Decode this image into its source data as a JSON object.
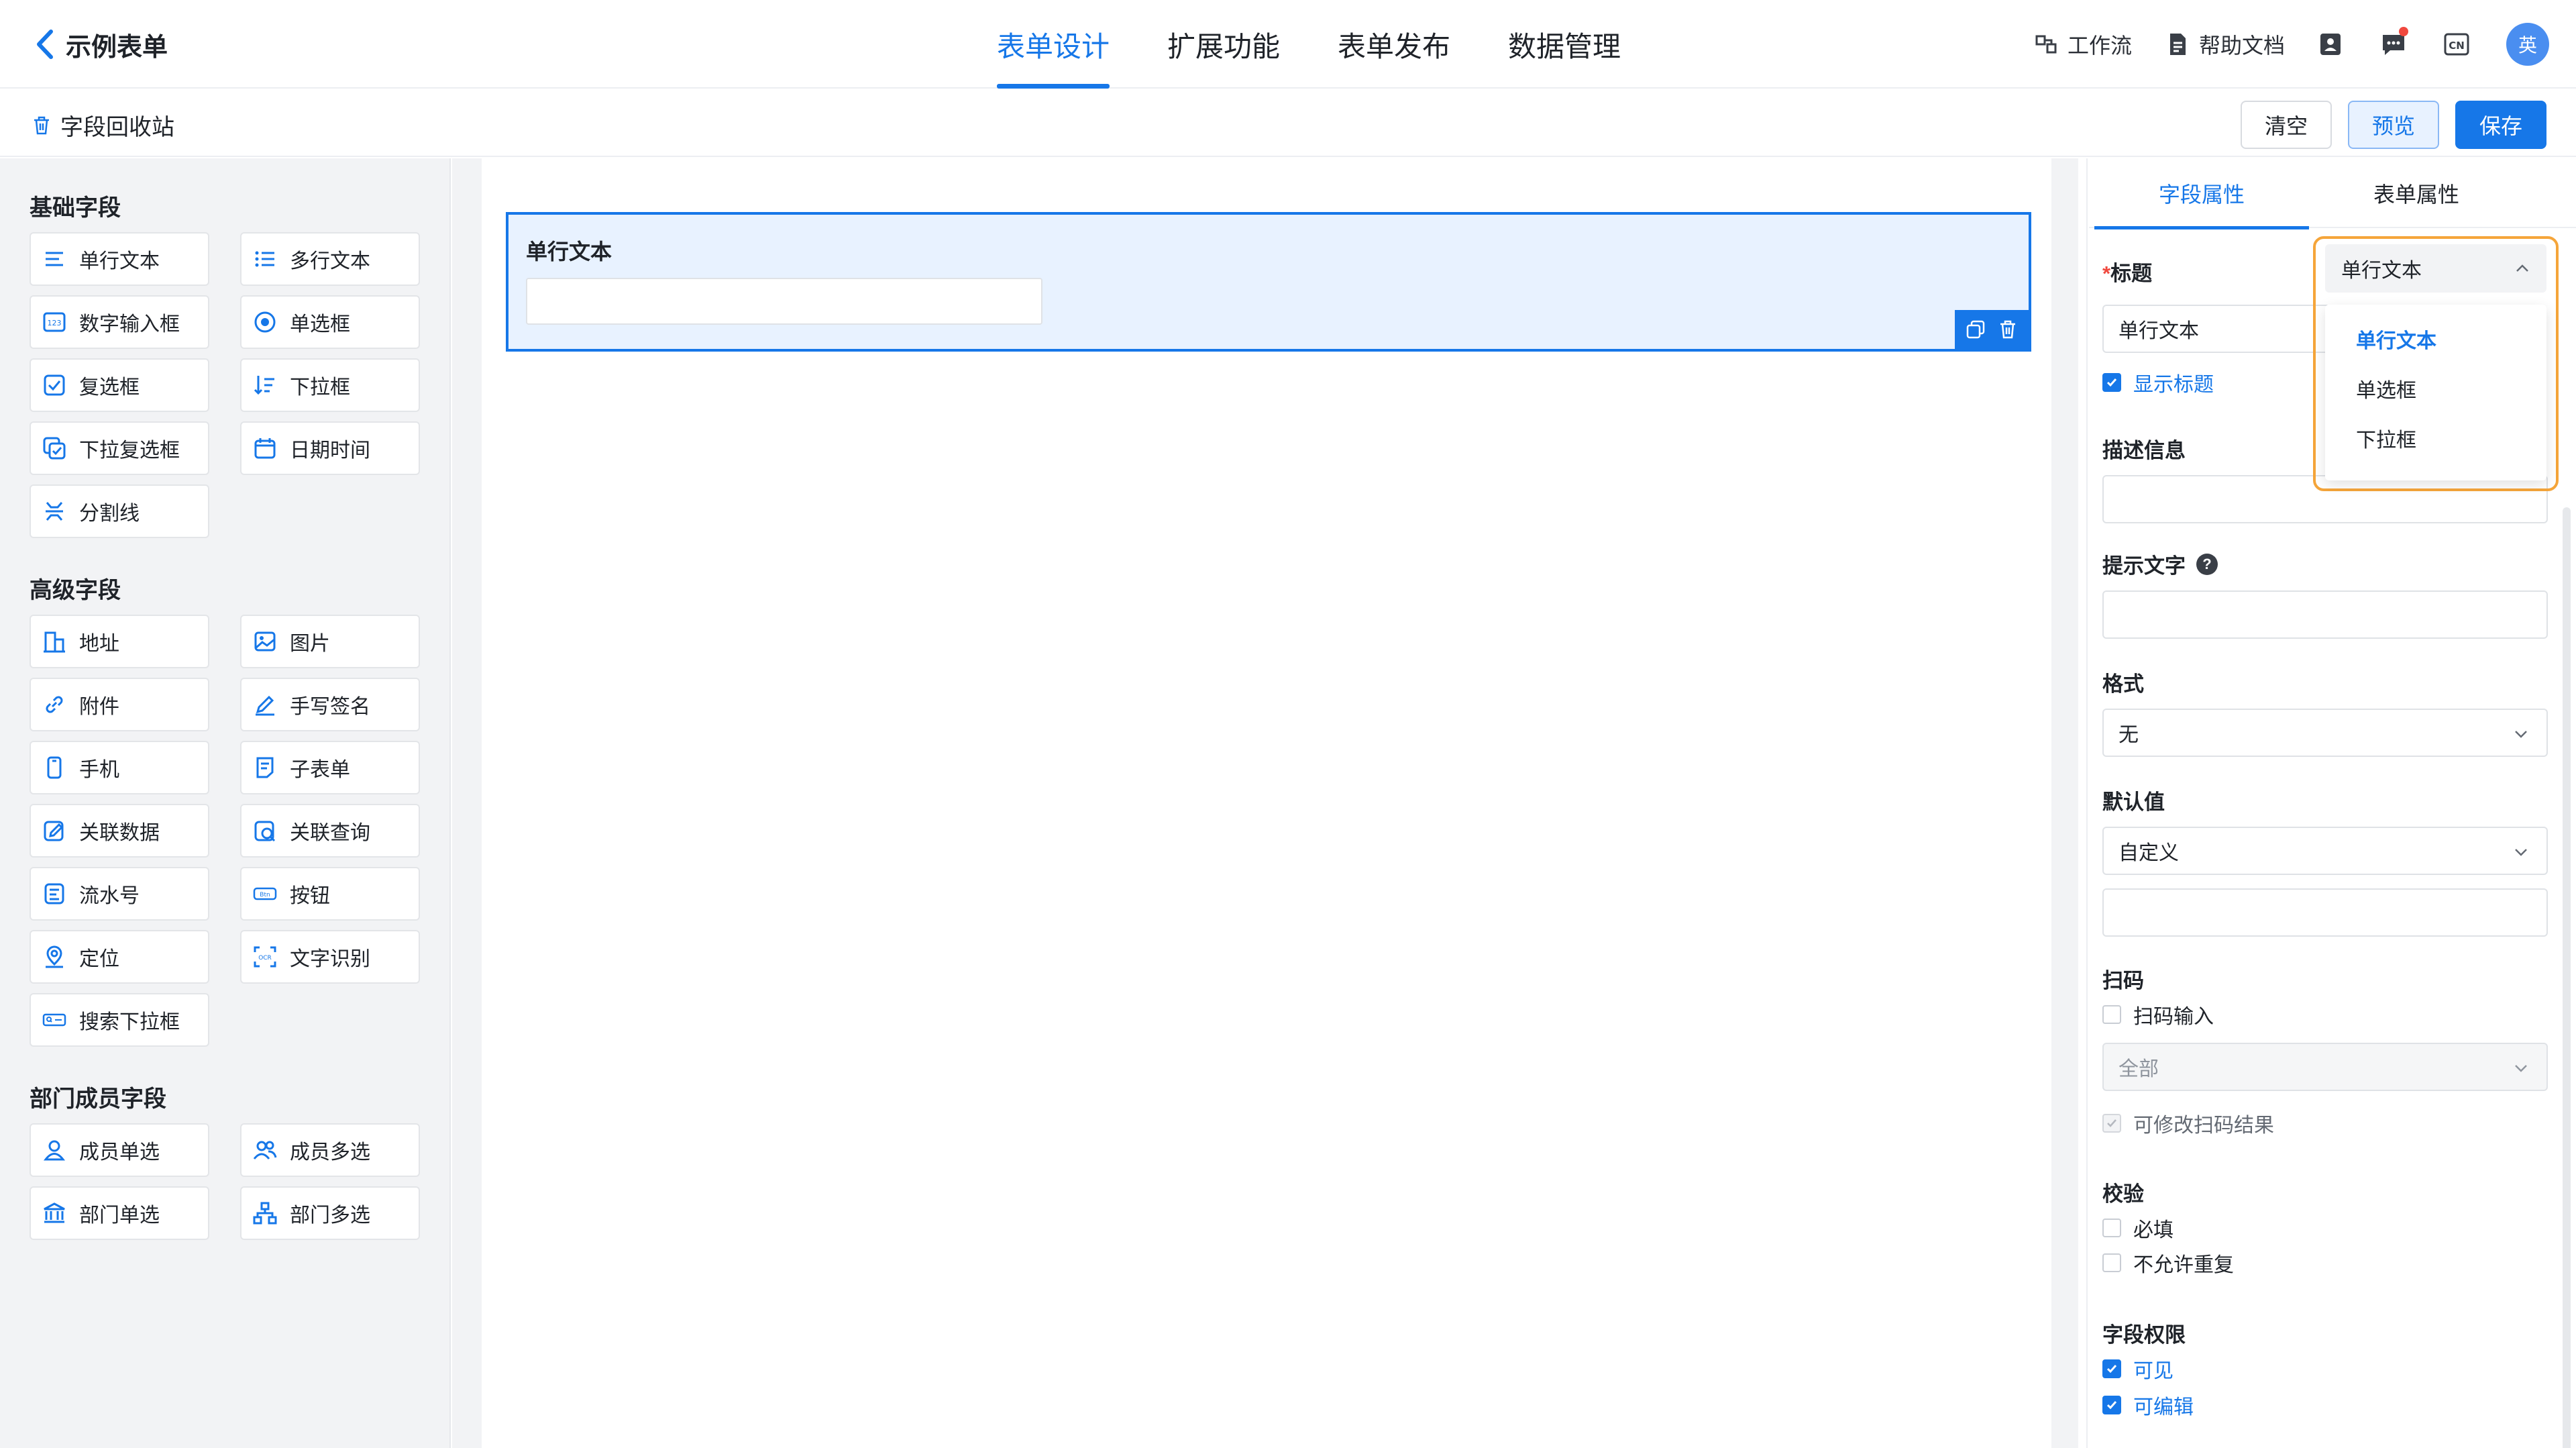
{
  "header": {
    "title": "示例表单",
    "tabs": [
      "表单设计",
      "扩展功能",
      "表单发布",
      "数据管理"
    ],
    "workflow": "工作流",
    "help_docs": "帮助文档",
    "lang_icon_text": "CN",
    "avatar_text": "英"
  },
  "subbar": {
    "recycle": "字段回收站",
    "clear": "清空",
    "preview": "预览",
    "save": "保存"
  },
  "palette": {
    "basic": {
      "title": "基础字段",
      "items": [
        "单行文本",
        "多行文本",
        "数字输入框",
        "单选框",
        "复选框",
        "下拉框",
        "下拉复选框",
        "日期时间",
        "分割线"
      ]
    },
    "advanced": {
      "title": "高级字段",
      "items": [
        "地址",
        "图片",
        "附件",
        "手写签名",
        "手机",
        "子表单",
        "关联数据",
        "关联查询",
        "流水号",
        "按钮",
        "定位",
        "文字识别",
        "搜索下拉框"
      ]
    },
    "member": {
      "title": "部门成员字段",
      "items": [
        "成员单选",
        "成员多选",
        "部门单选",
        "部门多选"
      ]
    }
  },
  "canvas": {
    "field_label": "单行文本"
  },
  "panel": {
    "tabs": [
      "字段属性",
      "表单属性"
    ],
    "title_label": "标题",
    "title_required_mark": "*",
    "title_value": "单行文本",
    "type_select": "单行文本",
    "type_options": [
      "单行文本",
      "单选框",
      "下拉框"
    ],
    "show_title": "显示标题",
    "desc_label": "描述信息",
    "hint_label": "提示文字",
    "format_label": "格式",
    "format_value": "无",
    "default_label": "默认值",
    "default_value": "自定义",
    "scan_label": "扫码",
    "scan_input": "扫码输入",
    "scan_scope": "全部",
    "scan_editable": "可修改扫码结果",
    "validate_label": "校验",
    "required": "必填",
    "no_duplicate": "不允许重复",
    "perm_label": "字段权限",
    "visible": "可见",
    "editable": "可编辑"
  },
  "colors": {
    "primary": "#1677e8",
    "highlight": "#f5a53a",
    "selected_bg": "#e8f2ff"
  }
}
